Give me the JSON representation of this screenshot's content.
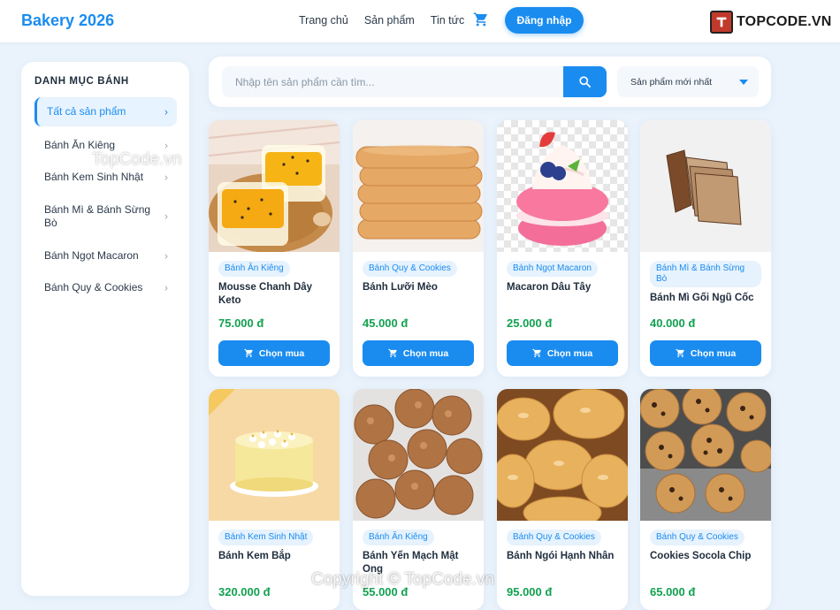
{
  "header": {
    "brand": "Bakery 2026",
    "nav": [
      "Trang chủ",
      "Sản phẩm",
      "Tin tức"
    ],
    "login_label": "Đăng nhập",
    "logo_text": "TOPCODE.VN"
  },
  "sidebar": {
    "title": "DANH MỤC BÁNH",
    "items": [
      {
        "label": "Tất cả sản phẩm",
        "active": true
      },
      {
        "label": "Bánh Ăn Kiêng"
      },
      {
        "label": "Bánh Kem Sinh Nhật"
      },
      {
        "label": "Bánh Mì & Bánh Sừng Bò"
      },
      {
        "label": "Bánh Ngọt Macaron"
      },
      {
        "label": "Bánh Quy & Cookies"
      }
    ]
  },
  "search": {
    "placeholder": "Nhập tên sản phẩm cần tìm...",
    "sort_selected": "Sản phẩm mới nhất"
  },
  "products": [
    {
      "category": "Bánh Ăn Kiêng",
      "name": "Mousse Chanh Dây Keto",
      "price": "75.000 đ",
      "buy_label": "Chọn mua"
    },
    {
      "category": "Bánh Quy & Cookies",
      "name": "Bánh Lưỡi Mèo",
      "price": "45.000 đ",
      "buy_label": "Chọn mua"
    },
    {
      "category": "Bánh Ngọt Macaron",
      "name": "Macaron Dâu Tây",
      "price": "25.000 đ",
      "buy_label": "Chọn mua"
    },
    {
      "category": "Bánh Mì & Bánh Sừng Bò",
      "name": "Bánh Mì Gối Ngũ Cốc",
      "price": "40.000 đ",
      "buy_label": "Chọn mua"
    },
    {
      "category": "Bánh Kem Sinh Nhật",
      "name": "Bánh Kem Bắp",
      "price": "320.000 đ"
    },
    {
      "category": "Bánh Ăn Kiêng",
      "name": "Bánh Yến Mạch Mật Ong",
      "price": "55.000 đ"
    },
    {
      "category": "Bánh Quy & Cookies",
      "name": "Bánh Ngói Hạnh Nhân",
      "price": "95.000 đ"
    },
    {
      "category": "Bánh Quy & Cookies",
      "name": "Cookies Socola Chip",
      "price": "65.000 đ"
    }
  ],
  "watermarks": {
    "top": "TopCode.vn",
    "bottom": "Copyright © TopCode.vn"
  },
  "colors": {
    "accent": "#1a8cf0",
    "price": "#12a150",
    "background": "#eaf3fc"
  }
}
